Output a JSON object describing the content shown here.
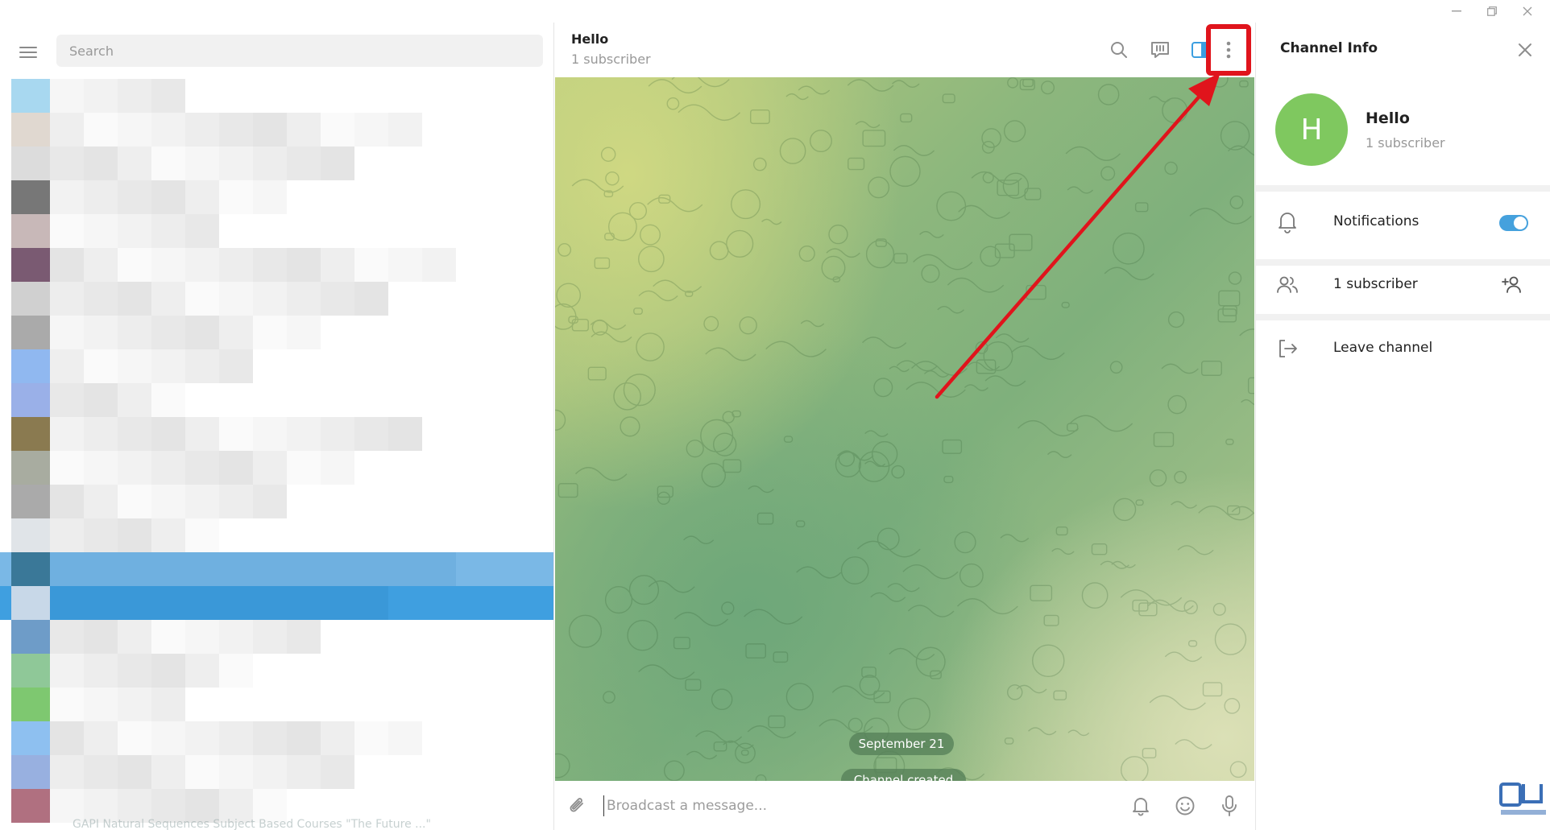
{
  "window": {
    "controls": [
      {
        "name": "minimize-button",
        "glyph": "—"
      },
      {
        "name": "restore-button",
        "glyph": "❐"
      },
      {
        "name": "close-window-button",
        "glyph": "✕"
      }
    ]
  },
  "sidebar": {
    "search_placeholder": "Search",
    "bottom_preview_text": "GAPI Natural Sequences Subject Based Courses \"The Future ...\""
  },
  "chat": {
    "title": "Hello",
    "subtitle": "1 subscriber",
    "header_icons": [
      "search-icon",
      "discussion-icon",
      "sidebar-toggle-icon",
      "more-options-icon"
    ],
    "service_messages": {
      "date": "September 21",
      "created": "Channel created"
    },
    "composer_placeholder": "Broadcast a message..."
  },
  "info_panel": {
    "title": "Channel Info",
    "avatar_letter": "H",
    "name": "Hello",
    "subtitle": "1 subscriber",
    "notifications_label": "Notifications",
    "notifications_on": true,
    "subscribers_label": "1 subscriber",
    "leave_label": "Leave channel"
  },
  "colors": {
    "accent": "#45a1dd",
    "avatar": "#7fc85f",
    "highlight": "#e0141c",
    "selected_row": "#3f9fe0"
  }
}
